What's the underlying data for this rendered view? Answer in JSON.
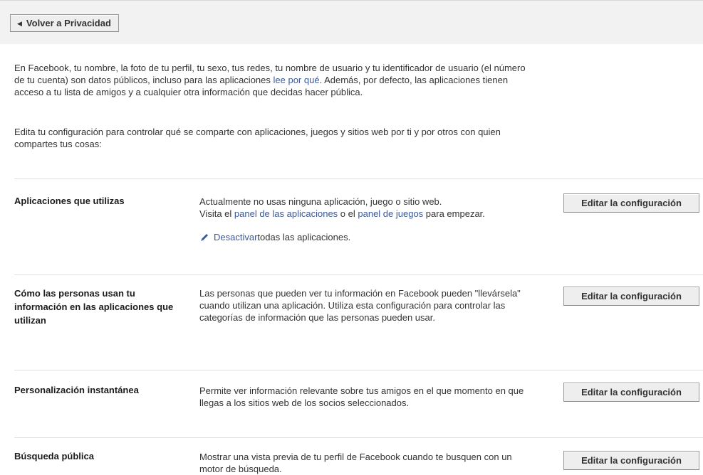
{
  "back_button": {
    "label": "Volver a Privacidad",
    "arrow_icon": "caret-left-icon"
  },
  "intro": {
    "p1_before_link": "En Facebook, tu nombre, la foto de tu perfil, tu sexo, tus redes, tu nombre de usuario y tu identificador de usuario (el número de tu cuenta) son datos públicos, incluso para las aplicaciones ",
    "p1_link": "lee por qué",
    "p1_after_link": ". Además, por defecto, las aplicaciones tienen acceso a tu lista de amigos y a cualquier otra información que decidas hacer pública.",
    "p2": "Edita tu configuración para controlar qué se comparte con aplicaciones, juegos y sitios web por ti y por otros con quien compartes tus cosas:"
  },
  "sections": [
    {
      "title": "Aplicaciones que utilizas",
      "desc_line1": "Actualmente no usas ninguna aplicación, juego o sitio web.",
      "desc_line2_pre": "Visita el ",
      "link_apps": "panel de las aplicaciones",
      "desc_line2_mid": " o el ",
      "link_games": "panel de juegos",
      "desc_line2_post": " para empezar.",
      "disable_link": "Desactivar",
      "disable_rest": " todas las aplicaciones.",
      "button": "Editar la configuración"
    },
    {
      "title": "Cómo las personas usan tu información en las aplicaciones que utilizan",
      "desc": "Las personas que pueden ver tu información en Facebook pueden \"llevársela\" cuando utilizan una aplicación. Utiliza esta configuración para controlar las categorías de información que las personas pueden usar.",
      "button": "Editar la configuración"
    },
    {
      "title": "Personalización instantánea",
      "desc": "Permite ver información relevante sobre tus amigos en el que momento en que llegas a los sitios web de los socios seleccionados.",
      "button": "Editar la configuración"
    },
    {
      "title": "Búsqueda pública",
      "desc": "Mostrar una vista previa de tu perfil de Facebook cuando te busquen con un motor de búsqueda.",
      "button": "Editar la configuración"
    }
  ],
  "colors": {
    "link": "#3b5998",
    "topbar": "#f2f2f2",
    "button_bg": "#eeeeee",
    "divider": "#e0e0e0"
  }
}
